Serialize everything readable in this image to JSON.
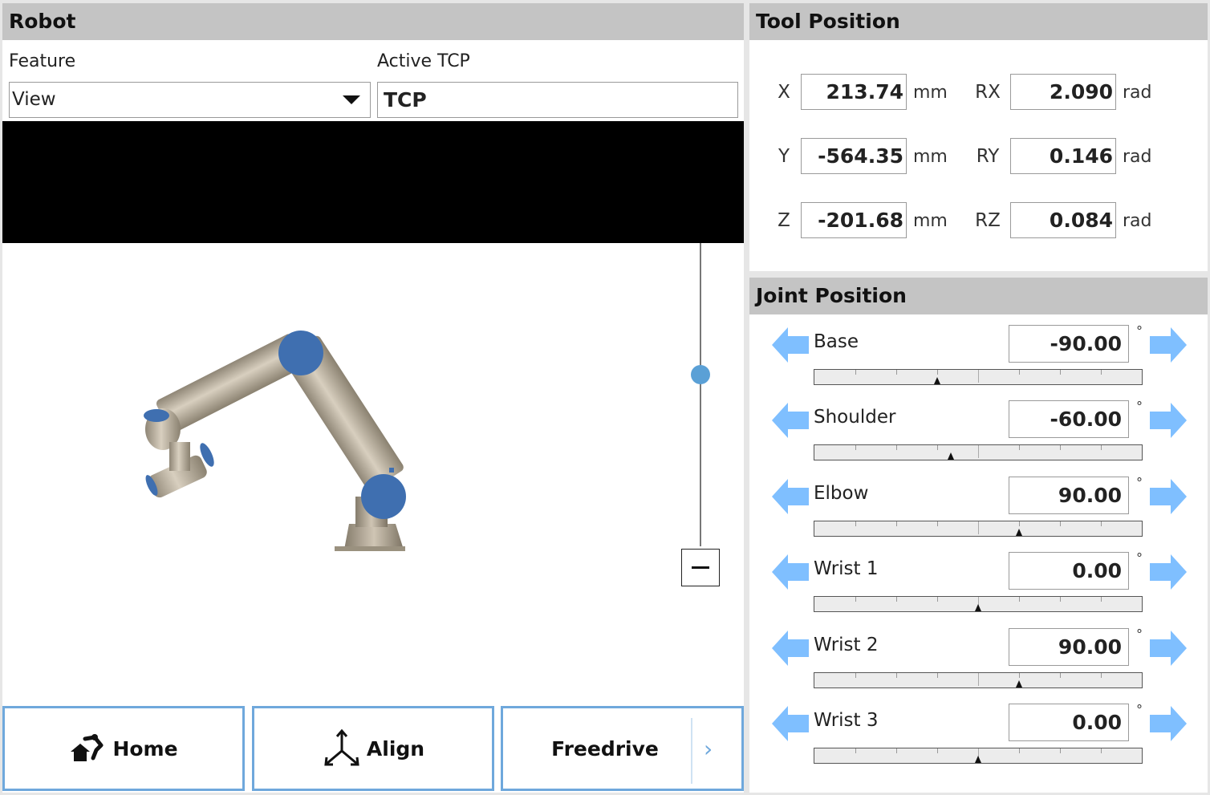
{
  "robot": {
    "title": "Robot",
    "feature_label": "Feature",
    "feature_value": "View",
    "active_tcp_label": "Active TCP",
    "active_tcp_value": "TCP",
    "buttons": {
      "home": "Home",
      "align": "Align",
      "freedrive": "Freedrive",
      "more": "›"
    },
    "zoom_level": 0.45
  },
  "tool": {
    "title": "Tool Position",
    "rows": [
      {
        "axis": "X",
        "value": "213.74",
        "unit": "mm",
        "raxis": "RX",
        "rvalue": "2.090",
        "runit": "rad"
      },
      {
        "axis": "Y",
        "value": "-564.35",
        "unit": "mm",
        "raxis": "RY",
        "rvalue": "0.146",
        "runit": "rad"
      },
      {
        "axis": "Z",
        "value": "-201.68",
        "unit": "mm",
        "raxis": "RZ",
        "rvalue": "0.084",
        "runit": "rad"
      }
    ]
  },
  "joints": {
    "title": "Joint Position",
    "unit": "°",
    "items": [
      {
        "name": "Base",
        "value": "-90.00",
        "level": 0.375
      },
      {
        "name": "Shoulder",
        "value": "-60.00",
        "level": 0.417
      },
      {
        "name": "Elbow",
        "value": "90.00",
        "level": 0.625
      },
      {
        "name": "Wrist 1",
        "value": "0.00",
        "level": 0.5
      },
      {
        "name": "Wrist 2",
        "value": "90.00",
        "level": 0.625
      },
      {
        "name": "Wrist 3",
        "value": "0.00",
        "level": 0.5
      }
    ]
  },
  "colors": {
    "header": "#c4c4c4",
    "accent": "#6fa8dc",
    "arrow": "#7fbfff",
    "robot_joint": "#3f6fb0",
    "robot_link": "#b8ad9c"
  }
}
